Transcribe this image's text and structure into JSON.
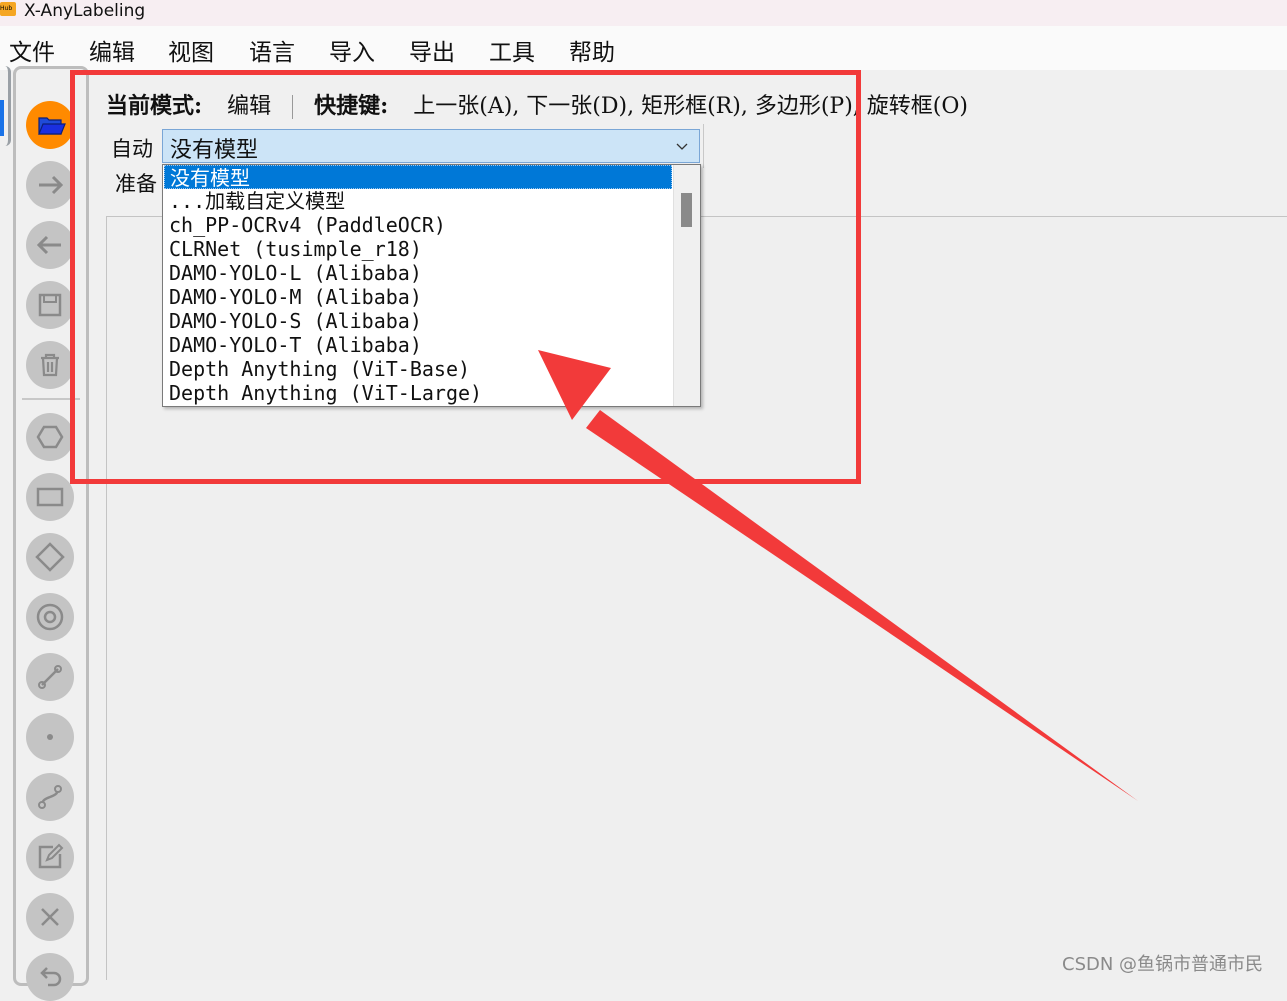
{
  "window": {
    "title": "X-AnyLabeling",
    "logo_text": "Hub"
  },
  "menubar": {
    "items": [
      {
        "label": "文件"
      },
      {
        "label": "编辑"
      },
      {
        "label": "视图"
      },
      {
        "label": "语言"
      },
      {
        "label": "导入"
      },
      {
        "label": "导出"
      },
      {
        "label": "工具"
      },
      {
        "label": "帮助"
      }
    ]
  },
  "status": {
    "mode_label": "当前模式:",
    "mode_value": "编辑",
    "shortcut_label": "快捷键:",
    "shortcut_value": "上一张(A), 下一张(D), 矩形框(R), 多边形(P), 旋转框(O)"
  },
  "auto": {
    "label": "自动",
    "selected_model": "没有模型",
    "ready_label": "准备"
  },
  "model_dropdown": {
    "options": [
      "没有模型",
      "...加载自定义模型",
      "ch_PP-OCRv4 (PaddleOCR)",
      "CLRNet (tusimple_r18)",
      "DAMO-YOLO-L (Alibaba)",
      "DAMO-YOLO-M (Alibaba)",
      "DAMO-YOLO-S (Alibaba)",
      "DAMO-YOLO-T (Alibaba)",
      "Depth Anything (ViT-Base)",
      "Depth Anything (ViT-Large)"
    ],
    "selected_index": 0
  },
  "toolbar": {
    "tools": [
      {
        "icon": "folder-open-icon"
      },
      {
        "icon": "arrow-right-icon"
      },
      {
        "icon": "arrow-left-icon"
      },
      {
        "icon": "save-icon"
      },
      {
        "icon": "trash-icon"
      },
      {
        "icon": "polygon-icon"
      },
      {
        "icon": "rectangle-icon"
      },
      {
        "icon": "rotated-box-icon"
      },
      {
        "icon": "circle-icon"
      },
      {
        "icon": "line-icon"
      },
      {
        "icon": "point-icon"
      },
      {
        "icon": "linestrip-icon"
      },
      {
        "icon": "edit-icon"
      },
      {
        "icon": "close-icon"
      },
      {
        "icon": "undo-icon"
      }
    ]
  },
  "annotation": {
    "highlight_color": "#f23a3a"
  },
  "watermark": "CSDN @鱼锅市普通市民",
  "colors": {
    "accent": "#0078d7",
    "open_button": "#ff8a00",
    "select_bg": "#cce4f7"
  }
}
